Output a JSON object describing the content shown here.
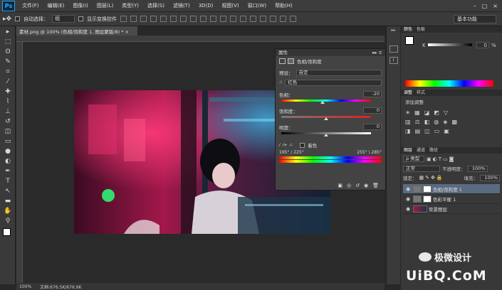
{
  "app": {
    "logo": "Ps"
  },
  "menu": [
    "文件(F)",
    "编辑(E)",
    "图像(I)",
    "图层(L)",
    "类型(Y)",
    "选择(S)",
    "滤镜(T)",
    "3D(D)",
    "视图(V)",
    "窗口(W)",
    "帮助(H)"
  ],
  "window_controls": {
    "minimize": "–",
    "maximize": "□",
    "close": "×"
  },
  "options": {
    "auto_select_label": "自动选择：",
    "auto_select_value": "组",
    "show_transform_label": "显示变换控件",
    "workspace": "基本功能"
  },
  "tool_icons": [
    "move-icon",
    "marquee-icon",
    "lasso-icon",
    "quick-select-icon",
    "crop-icon",
    "eyedropper-icon",
    "healing-icon",
    "brush-icon",
    "stamp-icon",
    "history-brush-icon",
    "eraser-icon",
    "gradient-icon",
    "blur-icon",
    "dodge-icon",
    "pen-icon",
    "type-icon",
    "path-select-icon",
    "shape-icon",
    "hand-icon",
    "zoom-icon"
  ],
  "tool_glyphs": [
    "▸",
    "⬚",
    "ʘ",
    "✎",
    "⌗",
    "⁄",
    "✚",
    "⌇",
    "⊥",
    "↺",
    "◫",
    "▭",
    "●",
    "◐",
    "✒",
    "T",
    "↖",
    "▬",
    "✋",
    "⚲"
  ],
  "document": {
    "tab_title": "素材.png @ 100% (色相/饱和度 1, 图层蒙版/8) *  ×",
    "zoom": "100%",
    "doc_size": "文档:676.5K/676.9K"
  },
  "properties": {
    "panel_title": "属性",
    "close": "▸▸ ≡",
    "adjust_title": "色相/饱和度",
    "preset_label": "预设：",
    "preset_value": "自定",
    "channel_value": "红色",
    "hue_label": "色相：",
    "hue_value": "-20",
    "saturation_label": "饱和度：",
    "saturation_value": "0",
    "lightness_label": "明度：",
    "lightness_value": "0",
    "colorize_label": "着色",
    "range_left": "195° / 225°",
    "range_right": "255° \\ 285°"
  },
  "color_panel": {
    "tabs": [
      "颜色",
      "色板"
    ],
    "k_label": "K",
    "k_value": "0",
    "pct": "%"
  },
  "adjust_panel": {
    "tabs": [
      "调整",
      "样式"
    ],
    "add_label": "添加调整"
  },
  "layers_panel": {
    "tabs": [
      "图层",
      "通道",
      "路径"
    ],
    "kind_label": "ρ 类型",
    "blend_mode": "正常",
    "opacity_label": "不透明度：",
    "opacity_value": "100%",
    "lock_label": "锁定：",
    "fill_label": "填充：",
    "fill_value": "100%",
    "layers": [
      {
        "name": "色相/饱和度 1",
        "selected": true
      },
      {
        "name": "色彩平衡 1",
        "selected": false
      },
      {
        "name": "背景图层",
        "selected": false
      }
    ]
  },
  "watermark": {
    "brand": "极微设计",
    "site": "UiBQ.CoM"
  },
  "colors": {
    "accent": "#2fa3f7",
    "panel": "#434343",
    "selected_layer": "#5a6a80"
  }
}
